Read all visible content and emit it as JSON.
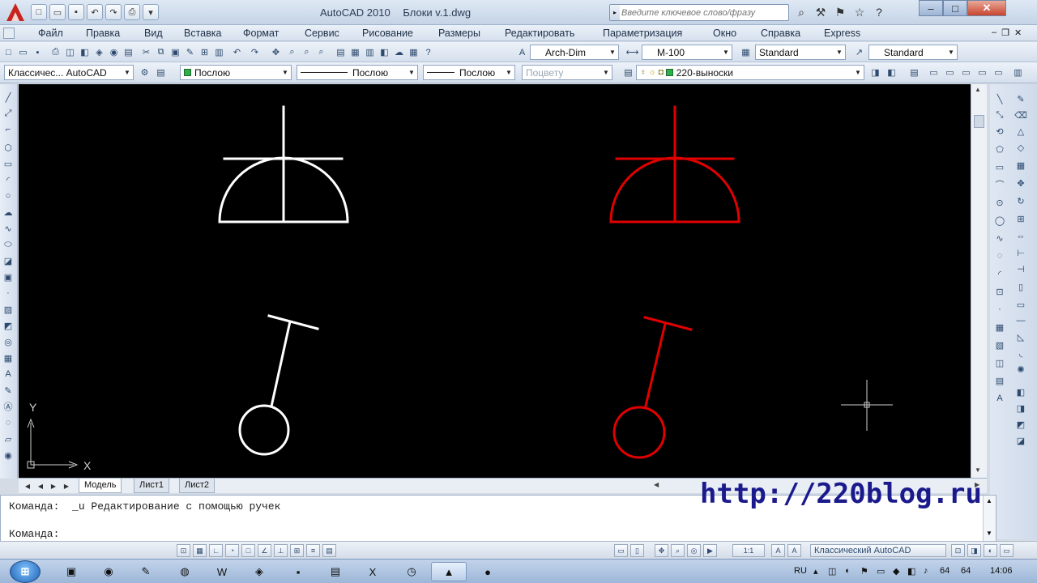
{
  "title": {
    "app_name": "AutoCAD 2010",
    "document": "Блоки v.1.dwg",
    "search_placeholder": "Введите ключевое слово/фразу"
  },
  "menu": {
    "items": [
      "Файл",
      "Правка",
      "Вид",
      "Вставка",
      "Формат",
      "Сервис",
      "Рисование",
      "Размеры",
      "Редактировать",
      "Параметризация",
      "Окно",
      "Справка",
      "Express"
    ]
  },
  "styles": {
    "text_style": "Arch-Dim",
    "dim_style": "M-100",
    "table_style": "Standard",
    "multileader_style": "Standard"
  },
  "properties": {
    "workspace": "Классичес... AutoCAD",
    "color": "Послою",
    "linetype": "Послою",
    "lineweight": "Послою",
    "plot_style": "Поцвету",
    "layer": "220-выноски"
  },
  "drawing": {
    "background": "#000000",
    "block_colors": [
      "#ffffff",
      "#e00000"
    ],
    "ucs_x_label": "X",
    "ucs_y_label": "Y"
  },
  "layout_tabs": [
    "Модель",
    "Лист1",
    "Лист2"
  ],
  "command": {
    "history_line": "Команда:  _u Редактирование с помощью ручек",
    "prompt": "Команда:",
    "input_value": ""
  },
  "watermark": "http://220blog.ru",
  "statusbar": {
    "scale": "1:1",
    "workspace": "Классический AutoCAD"
  },
  "taskbar": {
    "language": "RU",
    "tray_a": "64",
    "tray_b": "64",
    "time": "14:06"
  }
}
